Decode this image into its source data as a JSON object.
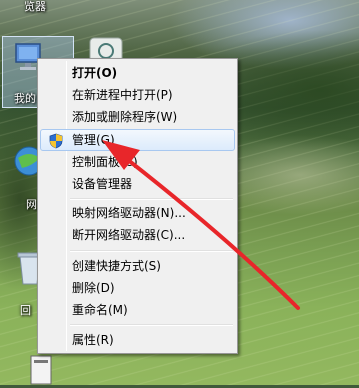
{
  "desktop": {
    "top_label": "览器",
    "icon_computer_label": "我的",
    "icon_network_label": "网",
    "icon_recycle_label": "回"
  },
  "context_menu": {
    "items": [
      {
        "label": "打开(O)",
        "bold": true
      },
      {
        "label": "在新进程中打开(P)"
      },
      {
        "label": "添加或删除程序(W)"
      },
      {
        "label": "管理(G)",
        "highlighted": true,
        "icon": "shield-icon"
      },
      {
        "label": "控制面板(C)"
      },
      {
        "label": "设备管理器"
      },
      {
        "label": "映射网络驱动器(N)..."
      },
      {
        "label": "断开网络驱动器(C)..."
      },
      {
        "label": "创建快捷方式(S)"
      },
      {
        "label": "删除(D)"
      },
      {
        "label": "重命名(M)"
      },
      {
        "label": "属性(R)"
      }
    ]
  },
  "colors": {
    "menu_bg": "#f0f0f0",
    "highlight_bg": "#dcebfc",
    "highlight_border": "#a8c8f0",
    "arrow": "#e8262a"
  }
}
